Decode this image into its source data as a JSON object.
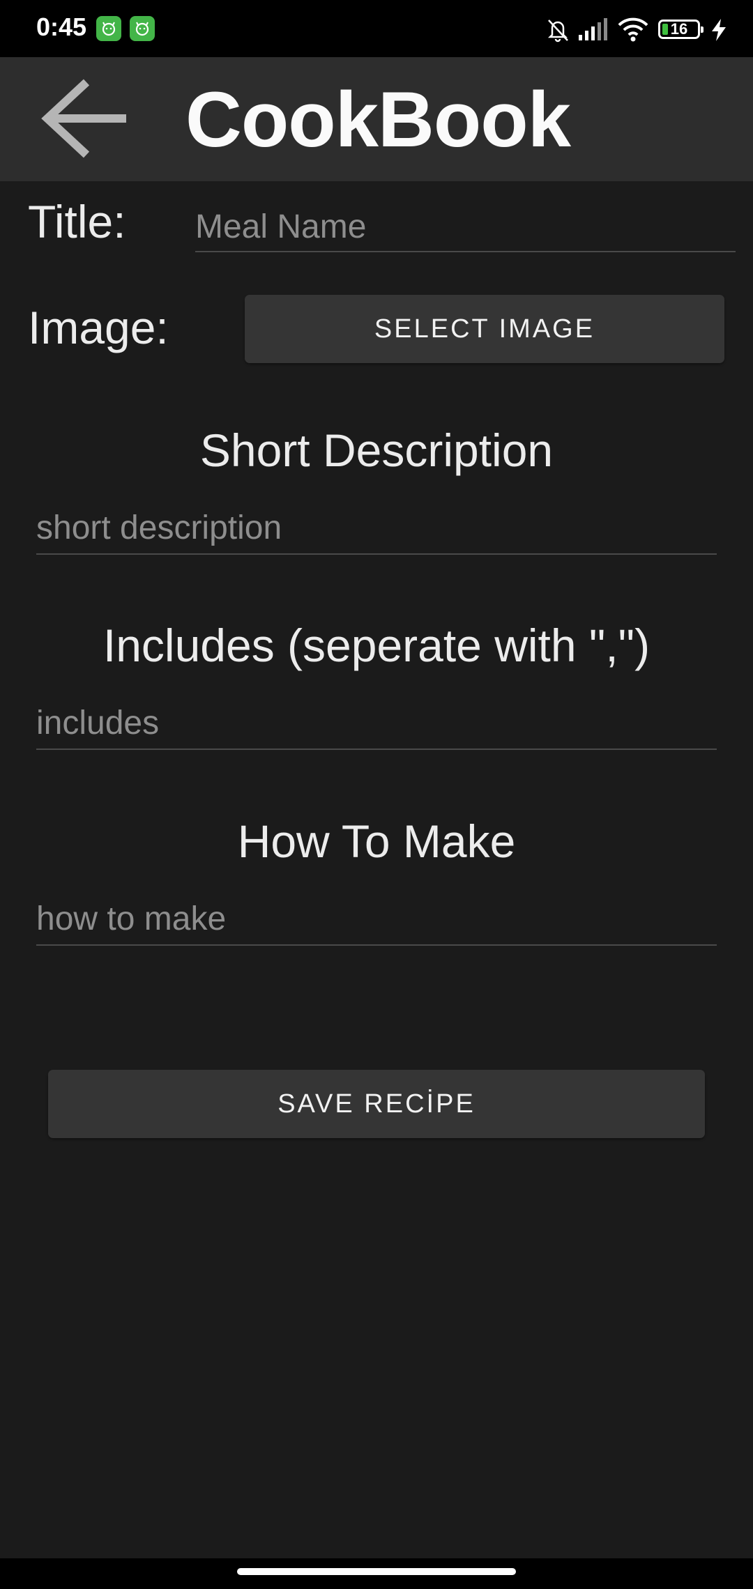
{
  "status_bar": {
    "time": "0:45",
    "battery_level": "16",
    "battery_fraction": 0.16,
    "icons": [
      "app-notification-icon",
      "app-notification-icon",
      "bell-off-icon",
      "cellular-signal-icon",
      "wifi-icon",
      "battery-icon",
      "charging-bolt-icon"
    ]
  },
  "app_bar": {
    "title": "CookBook",
    "back_icon": "arrow-left-icon"
  },
  "form": {
    "title_label": "Title:",
    "title_placeholder": "Meal Name",
    "image_label": "Image:",
    "select_image_label": "SELECT IMAGE",
    "short_description_heading": "Short Description",
    "short_description_placeholder": "short description",
    "includes_heading": "Includes (seperate with \",\")",
    "includes_placeholder": "includes",
    "how_to_make_heading": "How To Make",
    "how_to_make_placeholder": "how to make",
    "save_label": "SAVE RECİPE"
  },
  "colors": {
    "background": "#1b1b1b",
    "app_bar": "#2d2d2d",
    "button": "#353535",
    "notification_green": "#43b548"
  }
}
